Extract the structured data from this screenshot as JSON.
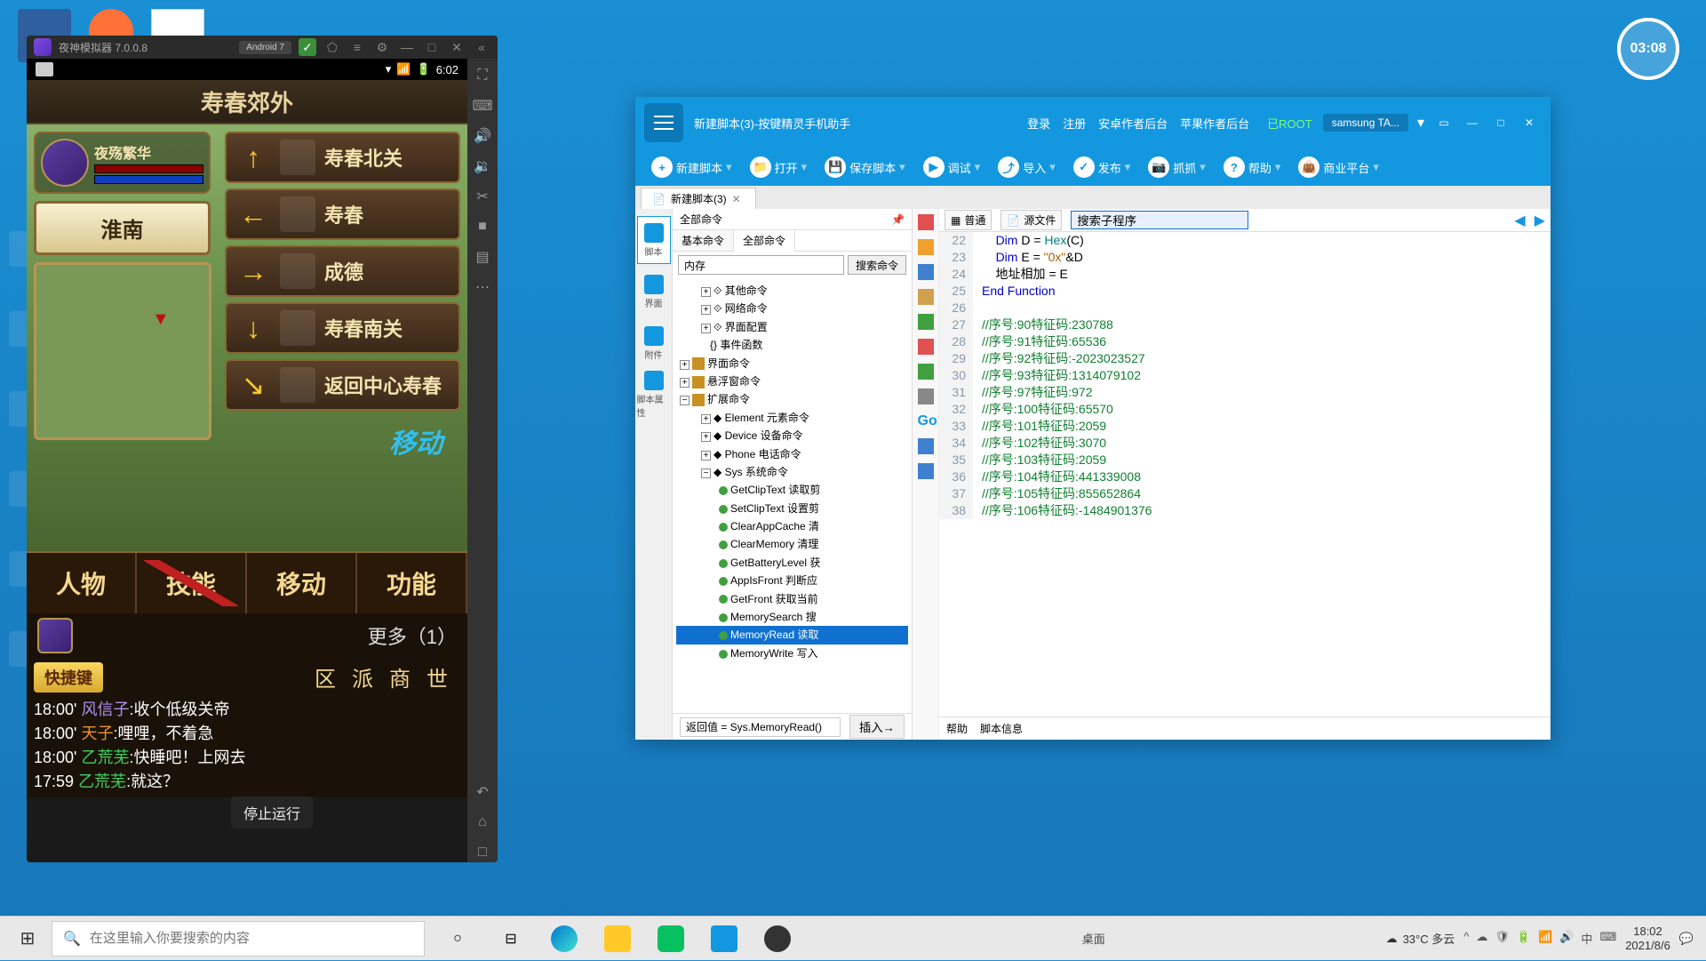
{
  "clock_widget": "03:08",
  "nox": {
    "title": "夜神模拟器 7.0.0.8",
    "android_badge": "Android 7",
    "status_time": "6:02"
  },
  "game": {
    "area_title": "寿春郊外",
    "player_name": "夜殇繁华",
    "location": "淮南",
    "destinations": [
      {
        "arrow": "↑",
        "name": "寿春北关"
      },
      {
        "arrow": "←",
        "name": "寿春"
      },
      {
        "arrow": "→",
        "name": "成德"
      },
      {
        "arrow": "↓",
        "name": "寿春南关"
      },
      {
        "arrow": "↘",
        "name": "返回中心寿春"
      }
    ],
    "action_label": "移动",
    "tabs": [
      "人物",
      "技能",
      "移动",
      "功能"
    ],
    "more_text": "更多（1）",
    "quick_key": "快捷键",
    "chat_tabs": [
      "区",
      "派",
      "商",
      "世"
    ],
    "chat_lines": [
      {
        "t": "18:00'",
        "u": "风信子",
        "c": "a",
        "m": ":收个低级关帝"
      },
      {
        "t": "18:00'",
        "u": "天子",
        "c": "b",
        "m": ":哩哩，不着急"
      },
      {
        "t": "18:00'",
        "u": "乙荒芜",
        "c": "c",
        "m": ":快睡吧！上网去"
      },
      {
        "t": "17:59",
        "u": "乙荒芜",
        "c": "c",
        "m": ":就这？"
      }
    ],
    "stop_overlay": "停止运行"
  },
  "editor": {
    "title": "新建脚本(3)-按键精灵手机助手",
    "links": [
      "登录",
      "注册",
      "安卓作者后台",
      "苹果作者后台"
    ],
    "root": "已ROOT",
    "device": "samsung  TA...",
    "toolbar": [
      {
        "icon": "+",
        "label": "新建脚本"
      },
      {
        "icon": "📁",
        "label": "打开"
      },
      {
        "icon": "💾",
        "label": "保存脚本"
      },
      {
        "icon": "▶",
        "label": "调试"
      },
      {
        "icon": "⤴",
        "label": "导入"
      },
      {
        "icon": "✓",
        "label": "发布"
      },
      {
        "icon": "📷",
        "label": "抓抓"
      },
      {
        "icon": "?",
        "label": "帮助"
      },
      {
        "icon": "👜",
        "label": "商业平台"
      }
    ],
    "tab_name": "新建脚本(3)",
    "left_nav": [
      "脚本",
      "界面",
      "附件",
      "脚本属性"
    ],
    "cmd_header": "全部命令",
    "cmd_tabs": [
      "基本命令",
      "全部命令"
    ],
    "search_placeholder": "内存",
    "search_btn": "搜索命令",
    "tree": {
      "other": "其他命令",
      "network": "网络命令",
      "ui_config": "界面配置",
      "event_fn": "事件函数",
      "window": "界面命令",
      "float": "悬浮窗命令",
      "ext": "扩展命令",
      "element": "Element 元素命令",
      "device": "Device 设备命令",
      "phone": "Phone 电话命令",
      "sys": "Sys 系统命令",
      "sys_items": [
        "GetClipText 读取剪",
        "SetClipText 设置剪",
        "ClearAppCache 清",
        "ClearMemory 清理",
        "GetBatteryLevel 获",
        "AppIsFront 判断应",
        "GetFront 获取当前",
        "MemorySearch 搜",
        "MemoryRead 读取",
        "MemoryWrite 写入"
      ]
    },
    "code_toolbar": {
      "view1": "普通",
      "view2": "源文件",
      "search_value": "搜索子程序"
    },
    "code_lines": [
      {
        "n": 22,
        "t": "    Dim D = Hex(C)",
        "cls": ""
      },
      {
        "n": 23,
        "t": "    Dim E = \"0x\"&D",
        "cls": ""
      },
      {
        "n": 24,
        "t": "    地址相加 = E",
        "cls": ""
      },
      {
        "n": 25,
        "t": "End Function",
        "cls": "kw"
      },
      {
        "n": 26,
        "t": "",
        "cls": ""
      },
      {
        "n": 27,
        "t": "//序号:90特征码:230788",
        "cls": "cmt"
      },
      {
        "n": 28,
        "t": "//序号:91特征码:65536",
        "cls": "cmt"
      },
      {
        "n": 29,
        "t": "//序号:92特征码:-2023023527",
        "cls": "cmt"
      },
      {
        "n": 30,
        "t": "//序号:93特征码:1314079102",
        "cls": "cmt"
      },
      {
        "n": 31,
        "t": "//序号:97特征码:972",
        "cls": "cmt"
      },
      {
        "n": 32,
        "t": "//序号:100特征码:65570",
        "cls": "cmt"
      },
      {
        "n": 33,
        "t": "//序号:101特征码:2059",
        "cls": "cmt"
      },
      {
        "n": 34,
        "t": "//序号:102特征码:3070",
        "cls": "cmt"
      },
      {
        "n": 35,
        "t": "//序号:103特征码:2059",
        "cls": "cmt"
      },
      {
        "n": 36,
        "t": "//序号:104特征码:441339008",
        "cls": "cmt"
      },
      {
        "n": 37,
        "t": "//序号:105特征码:855652864",
        "cls": "cmt"
      },
      {
        "n": 38,
        "t": "//序号:106特征码:-1484901376",
        "cls": "cmt"
      }
    ],
    "return_value": "返回值 = Sys.MemoryRead()",
    "insert_btn": "插入→",
    "bottom_tabs": [
      "帮助",
      "脚本信息"
    ]
  },
  "taskbar": {
    "search_placeholder": "在这里输入你要搜索的内容",
    "center": "桌面",
    "weather": "33°C 多云",
    "ime": "中",
    "time": "18:02",
    "date": "2021/8/6"
  }
}
